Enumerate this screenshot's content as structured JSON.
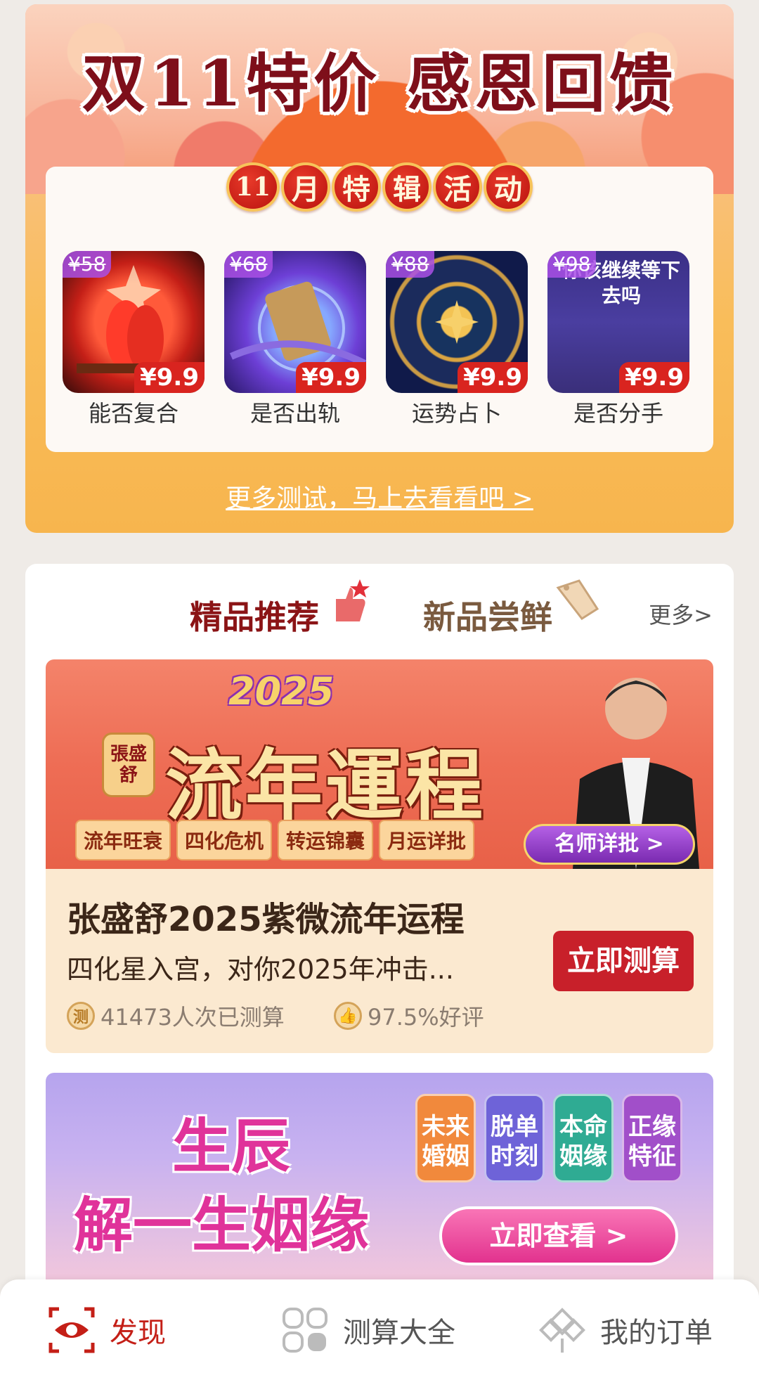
{
  "promo": {
    "title": "双11特价 感恩回馈",
    "activity_chars": [
      "11",
      "月",
      "特",
      "辑",
      "活",
      "动"
    ],
    "products": [
      {
        "old_price": "¥58",
        "new_price": "¥9.9",
        "name": "能否复合"
      },
      {
        "old_price": "¥68",
        "new_price": "¥9.9",
        "name": "是否出轨"
      },
      {
        "old_price": "¥88",
        "new_price": "¥9.9",
        "name": "运势占卜"
      },
      {
        "old_price": "¥98",
        "new_price": "¥9.9",
        "name": "是否分手",
        "image_text": "你该继续等下去吗"
      }
    ],
    "more_link": "更多测试，马上去看看吧 >"
  },
  "recommend": {
    "tab_featured": "精品推荐",
    "tab_new": "新品尝鲜",
    "more": "更多>",
    "banner1": {
      "year": "2025",
      "seal": "張盛舒",
      "title": "流年運程",
      "chips": [
        "流年旺衰",
        "四化危机",
        "转运锦囊",
        "月运详批"
      ],
      "button": "名师详批 >"
    },
    "card": {
      "title": "张盛舒2025紫微流年运程",
      "desc": "四化星入宫，对你2025年冲击...",
      "count_icon": "测",
      "count": "41473人次已测算",
      "rating": "97.5%好评",
      "button": "立即测算"
    },
    "banner2": {
      "line1": "生辰",
      "line2": "解一生姻缘",
      "tags": [
        "未来婚姻",
        "脱单时刻",
        "本命姻缘",
        "正缘特征"
      ],
      "button": "立即查看 >"
    }
  },
  "nav": {
    "discover": "发现",
    "catalog": "测算大全",
    "orders": "我的订单",
    "active_color": "#c41f17"
  }
}
